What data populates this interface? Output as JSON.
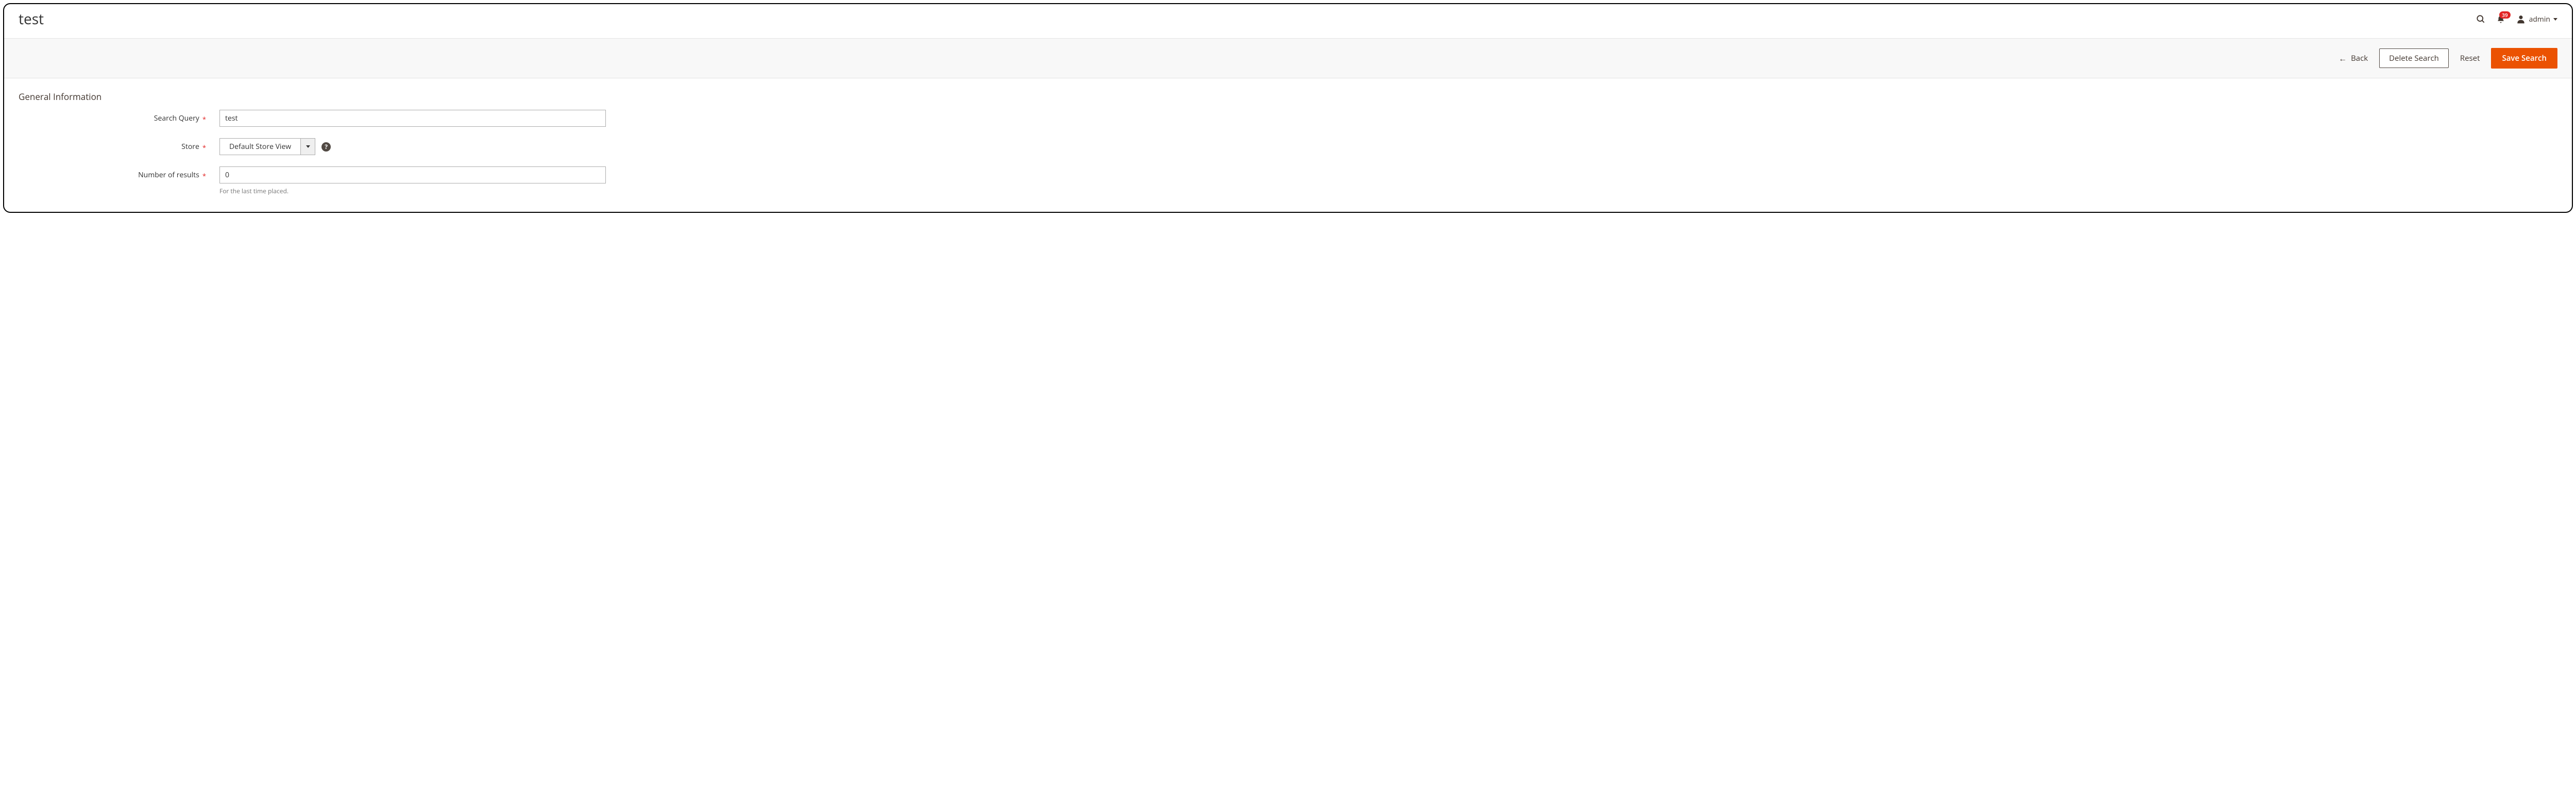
{
  "header": {
    "page_title": "test",
    "notification_count": "39",
    "username": "admin"
  },
  "actions": {
    "back": "Back",
    "delete": "Delete Search",
    "reset": "Reset",
    "save": "Save Search"
  },
  "section": {
    "title": "General Information"
  },
  "form": {
    "search_query": {
      "label": "Search Query",
      "value": "test"
    },
    "store": {
      "label": "Store",
      "value": "Default Store View"
    },
    "number_of_results": {
      "label": "Number of results",
      "value": "0",
      "hint": "For the last time placed."
    }
  }
}
